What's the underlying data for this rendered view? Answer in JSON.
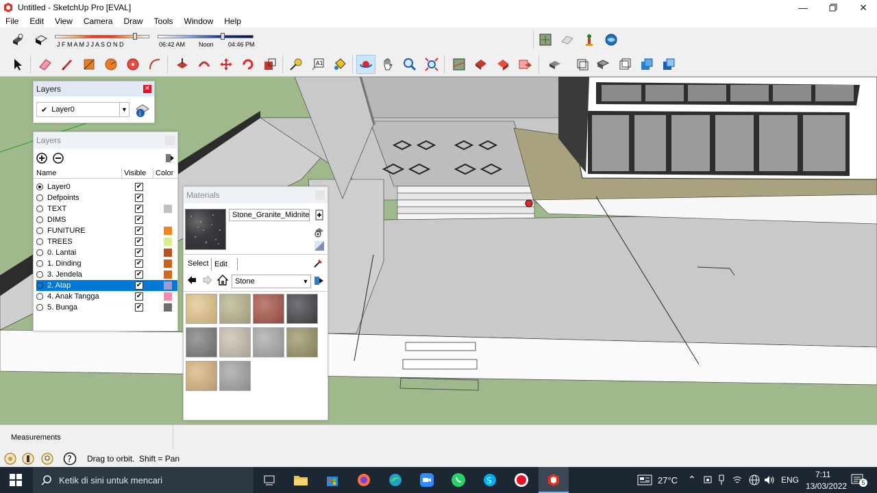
{
  "window": {
    "title": "Untitled - SketchUp Pro [EVAL]"
  },
  "menu": [
    "File",
    "Edit",
    "View",
    "Camera",
    "Draw",
    "Tools",
    "Window",
    "Help"
  ],
  "shadow_slider": {
    "months": "J F M A M J J A S O N D",
    "time_start": "06:42 AM",
    "time_mid": "Noon",
    "time_end": "04:46 PM"
  },
  "layers_small": {
    "title": "Layers",
    "current_layer": "Layer0"
  },
  "layers_panel": {
    "title": "Layers",
    "col_name": "Name",
    "col_visible": "Visible",
    "col_color": "Color",
    "rows": [
      {
        "name": "Layer0",
        "active": true,
        "visible": true,
        "color": ""
      },
      {
        "name": "Defpoints",
        "active": false,
        "visible": true,
        "color": ""
      },
      {
        "name": "TEXT",
        "active": false,
        "visible": true,
        "color": "#c0c0c0"
      },
      {
        "name": "DIMS",
        "active": false,
        "visible": true,
        "color": ""
      },
      {
        "name": "FUNITURE",
        "active": false,
        "visible": true,
        "color": "#f5821f"
      },
      {
        "name": "TREES",
        "active": false,
        "visible": true,
        "color": "#d8f08a"
      },
      {
        "name": "0. Lantai",
        "active": false,
        "visible": true,
        "color": "#b5551a"
      },
      {
        "name": "1. Dinding",
        "active": false,
        "visible": true,
        "color": "#c8631e"
      },
      {
        "name": "3. Jendela",
        "active": false,
        "visible": true,
        "color": "#d2691e"
      },
      {
        "name": "2. Atap",
        "active": false,
        "visible": true,
        "color": "#9b9bd4",
        "selected": true
      },
      {
        "name": "4. Anak Tangga",
        "active": false,
        "visible": true,
        "color": "#f58bb0"
      },
      {
        "name": "5. Bunga",
        "active": false,
        "visible": true,
        "color": "#6e6e6e"
      }
    ]
  },
  "materials_panel": {
    "title": "Materials",
    "current_material": "Stone_Granite_Midnite",
    "tab_select": "Select",
    "tab_edit": "Edit",
    "library": "Stone",
    "tiles": [
      "#e3c58a",
      "#b9b48e",
      "#a8564a",
      "#45464b",
      "#7d7b7e",
      "#c7bfae",
      "#a9a9ab",
      "#9a9466",
      "#d8b47e",
      "#a3a3a6"
    ]
  },
  "status": {
    "measurements_label": "Measurements",
    "hint": "Drag to orbit.  Shift = Pan"
  },
  "taskbar": {
    "search_placeholder": "Ketik di sini untuk mencari",
    "weather": "27°C",
    "language": "ENG",
    "time": "7:11",
    "date": "13/03/2022",
    "notifications": "5"
  }
}
